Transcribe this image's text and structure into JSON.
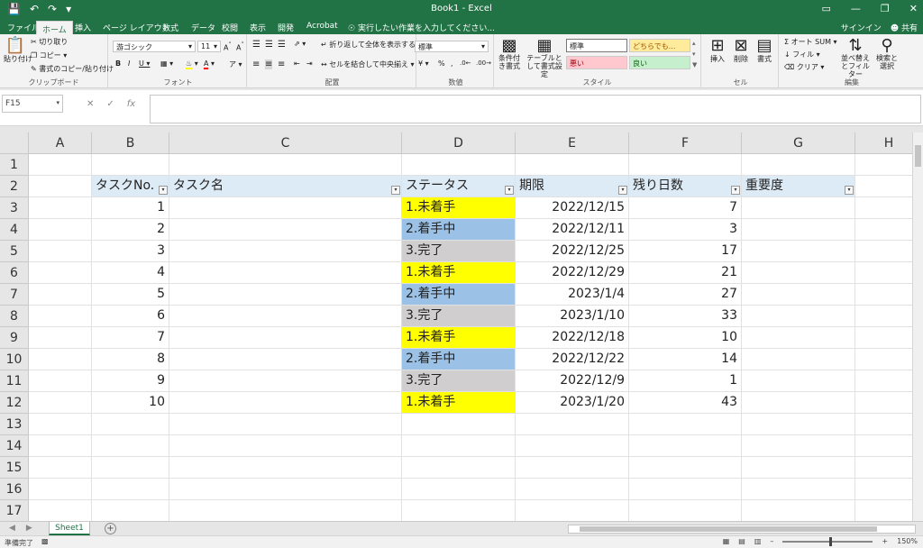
{
  "titlebar": {
    "title": "Book1 - Excel",
    "save_icon": "save-icon",
    "undo_icon": "undo-icon",
    "redo_icon": "redo-icon"
  },
  "tabs": [
    {
      "label": "ファイル"
    },
    {
      "label": "ホーム"
    },
    {
      "label": "挿入"
    },
    {
      "label": "ページ レイアウト"
    },
    {
      "label": "数式"
    },
    {
      "label": "データ"
    },
    {
      "label": "校閲"
    },
    {
      "label": "表示"
    },
    {
      "label": "開発"
    },
    {
      "label": "Acrobat"
    }
  ],
  "tell_me": "実行したい作業を入力してください...",
  "signin": "サインイン",
  "share": "共有",
  "ribbon": {
    "clipboard": {
      "paste": "貼り付け",
      "cut": "切り取り",
      "copy": "コピー",
      "format_painter": "書式のコピー/貼り付け",
      "label": "クリップボード"
    },
    "font": {
      "name": "游ゴシック",
      "size": "11",
      "label": "フォント"
    },
    "alignment": {
      "wrap": "折り返して全体を表示する",
      "merge": "セルを結合して中央揃え",
      "label": "配置"
    },
    "number": {
      "format": "標準",
      "label": "数値"
    },
    "styles": {
      "conditional": "条件付き書式",
      "table": "テーブルとして書式設定",
      "normal": "標準",
      "neutral": "どちらでも...",
      "bad": "悪い",
      "good": "良い",
      "label": "スタイル"
    },
    "cells": {
      "insert": "挿入",
      "delete": "削除",
      "format": "書式",
      "label": "セル"
    },
    "editing": {
      "autosum": "オート SUM",
      "fill": "フィル",
      "clear": "クリア",
      "sort": "並べ替えとフィルター",
      "find": "検索と選択",
      "label": "編集"
    }
  },
  "namebox": "F15",
  "columns": [
    "A",
    "B",
    "C",
    "D",
    "E",
    "F",
    "G",
    "H"
  ],
  "rows": [
    "1",
    "2",
    "3",
    "4",
    "5",
    "6",
    "7",
    "8",
    "9",
    "10",
    "11",
    "12",
    "13",
    "14",
    "15",
    "16",
    "17"
  ],
  "table": {
    "headers": [
      "タスクNo.",
      "タスク名",
      "ステータス",
      "期限",
      "残り日数",
      "重要度"
    ],
    "rows": [
      {
        "no": "1",
        "status": "1.未着手",
        "due": "2022/12/15",
        "days": "7"
      },
      {
        "no": "2",
        "status": "2.着手中",
        "due": "2022/12/11",
        "days": "3"
      },
      {
        "no": "3",
        "status": "3.完了",
        "due": "2022/12/25",
        "days": "17"
      },
      {
        "no": "4",
        "status": "1.未着手",
        "due": "2022/12/29",
        "days": "21"
      },
      {
        "no": "5",
        "status": "2.着手中",
        "due": "2023/1/4",
        "days": "27"
      },
      {
        "no": "6",
        "status": "3.完了",
        "due": "2023/1/10",
        "days": "33"
      },
      {
        "no": "7",
        "status": "1.未着手",
        "due": "2022/12/18",
        "days": "10"
      },
      {
        "no": "8",
        "status": "2.着手中",
        "due": "2022/12/22",
        "days": "14"
      },
      {
        "no": "9",
        "status": "3.完了",
        "due": "2022/12/9",
        "days": "1"
      },
      {
        "no": "10",
        "status": "1.未着手",
        "due": "2023/1/20",
        "days": "43"
      }
    ]
  },
  "colors": {
    "brand": "#217346",
    "status_todo": "#ffff00",
    "status_doing": "#9bc2e6",
    "status_done": "#d0cece",
    "header_fill": "#ddebf7"
  },
  "sheet_tab": "Sheet1",
  "status_text": "準備完了",
  "zoom": "150%"
}
